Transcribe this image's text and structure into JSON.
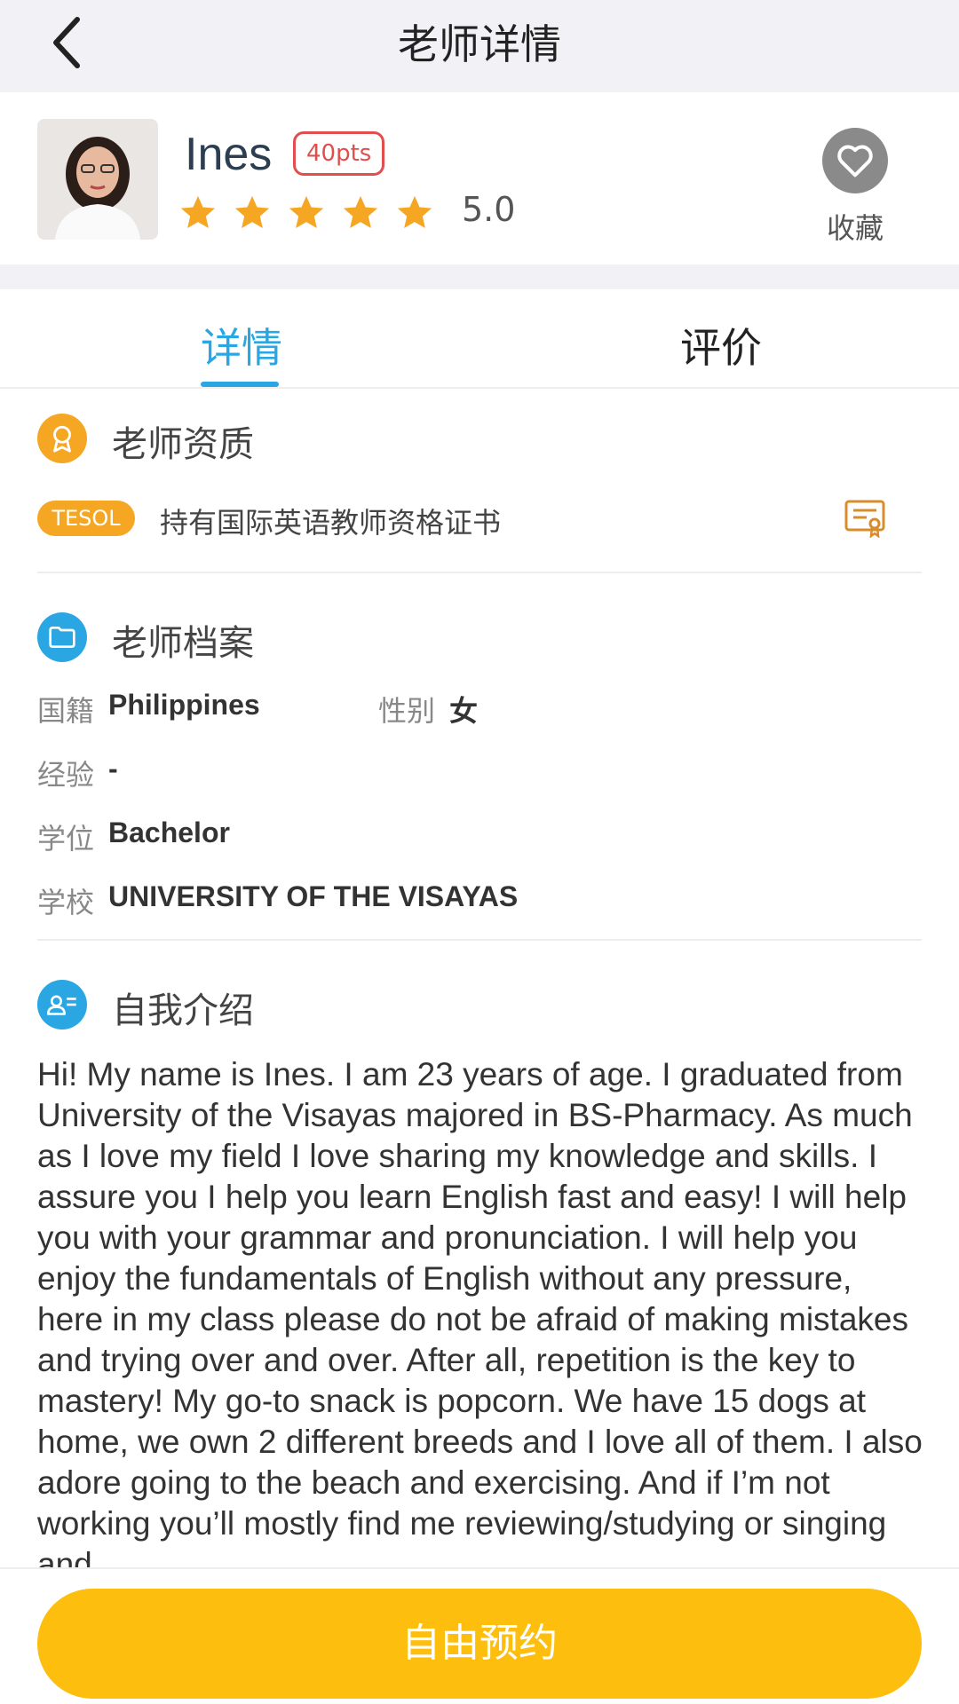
{
  "header": {
    "title": "老师详情"
  },
  "teacher": {
    "name": "Ines",
    "points": "40pts",
    "rating_value": "5.0",
    "stars": 5,
    "favorite_label": "收藏"
  },
  "tabs": [
    {
      "label": "详情",
      "active": true
    },
    {
      "label": "评价",
      "active": false
    }
  ],
  "qualification": {
    "title": "老师资质",
    "badge": "TESOL",
    "text": "持有国际英语教师资格证书"
  },
  "profile_info": {
    "title": "老师档案",
    "fields": [
      {
        "label": "国籍",
        "value": "Philippines"
      },
      {
        "label": "性别",
        "value": "女"
      },
      {
        "label": "经验",
        "value": "-"
      },
      {
        "label": "学位",
        "value": "Bachelor"
      },
      {
        "label": "学校",
        "value": "UNIVERSITY OF THE VISAYAS"
      }
    ]
  },
  "intro": {
    "title": "自我介绍",
    "text": "Hi! My name is Ines. I am 23 years of age. I graduated from University of the Visayas majored in BS-Pharmacy. As much as I love my field I love sharing my knowledge and skills. I assure you I help you learn English fast and easy! I will help you with your grammar and pronunciation. I will help you enjoy the fundamentals of English without any pressure, here in my class please do not be afraid of making mistakes and trying over and over. After all, repetition is the key to mastery! My go-to snack is popcorn. We have 15 dogs at home, we own 2 different breeds and I love all of them. I also adore going to the beach and exercising. And if I’m not working you’ll mostly find me reviewing/studying or singing and"
  },
  "actions": {
    "book_label": "自由预约"
  },
  "colors": {
    "accent": "#2aa7e3",
    "gold": "#f5a623",
    "button": "#fdbe0e",
    "badge_red": "#e24d4d"
  }
}
